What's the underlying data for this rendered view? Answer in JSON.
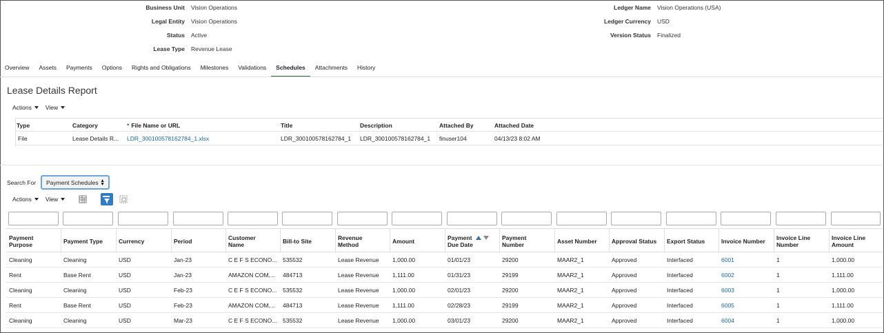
{
  "header": {
    "left": [
      {
        "label": "Business Unit",
        "value": "Vision Operations"
      },
      {
        "label": "Legal Entity",
        "value": "Vision Operations"
      },
      {
        "label": "Status",
        "value": "Active"
      },
      {
        "label": "Lease Type",
        "value": "Revenue Lease"
      }
    ],
    "right": [
      {
        "label": "Ledger Name",
        "value": "Vision Operations (USA)"
      },
      {
        "label": "Ledger Currency",
        "value": "USD"
      },
      {
        "label": "Version Status",
        "value": "Finalized"
      }
    ]
  },
  "tabs": [
    "Overview",
    "Assets",
    "Payments",
    "Options",
    "Rights and Obligations",
    "Milestones",
    "Validations",
    "Schedules",
    "Attachments",
    "History"
  ],
  "active_tab": "Schedules",
  "section_title": "Lease Details Report",
  "toolbar1": {
    "actions": "Actions",
    "view": "View"
  },
  "attachments": {
    "columns": [
      "Type",
      "Category",
      "File Name or URL",
      "Title",
      "Description",
      "Attached By",
      "Attached Date"
    ],
    "required_marker": "*",
    "rows": [
      {
        "type": "File",
        "category": "Lease Details R...",
        "file": "LDR_300100578162784_1.xlsx",
        "title": "LDR_300100578162784_1",
        "description": "LDR_300100578162784_1",
        "attached_by": "finuser104",
        "attached_date": "04/13/23 8:02 AM"
      }
    ]
  },
  "search": {
    "label": "Search For",
    "value": "Payment Schedules"
  },
  "toolbar2": {
    "actions": "Actions",
    "view": "View"
  },
  "payments": {
    "columns": [
      [
        "Payment",
        "Purpose"
      ],
      [
        "Payment Type",
        ""
      ],
      [
        "Currency",
        ""
      ],
      [
        "Period",
        ""
      ],
      [
        "Customer",
        "Name"
      ],
      [
        "Bill-to Site",
        ""
      ],
      [
        "Revenue",
        "Method"
      ],
      [
        "Amount",
        ""
      ],
      [
        "Payment",
        "Due Date"
      ],
      [
        "Payment",
        "Number"
      ],
      [
        "Asset Number",
        ""
      ],
      [
        "Approval Status",
        ""
      ],
      [
        "Export Status",
        ""
      ],
      [
        "Invoice Number",
        ""
      ],
      [
        "Invoice Line",
        "Number"
      ],
      [
        "Invoice Line",
        "Amount"
      ]
    ],
    "rows": [
      [
        "Cleaning",
        "Cleaning",
        "USD",
        "Jan-23",
        "C E F S ECONO...",
        "535532",
        "Lease Revenue",
        "1,000.00",
        "01/01/23",
        "29200",
        "MAAR2_1",
        "Approved",
        "Interfaced",
        "6001",
        "1",
        "1,000.00"
      ],
      [
        "Rent",
        "Base Rent",
        "USD",
        "Jan-23",
        "AMAZON COM,...",
        "484713",
        "Lease Revenue",
        "1,111.00",
        "01/31/23",
        "29199",
        "MAAR2_1",
        "Approved",
        "Interfaced",
        "6002",
        "1",
        "1,111.00"
      ],
      [
        "Cleaning",
        "Cleaning",
        "USD",
        "Feb-23",
        "C E F S ECONO...",
        "535532",
        "Lease Revenue",
        "1,000.00",
        "02/01/23",
        "29200",
        "MAAR2_1",
        "Approved",
        "Interfaced",
        "6003",
        "1",
        "1,000.00"
      ],
      [
        "Rent",
        "Base Rent",
        "USD",
        "Feb-23",
        "AMAZON COM,...",
        "484713",
        "Lease Revenue",
        "1,111.00",
        "02/28/23",
        "29199",
        "MAAR2_1",
        "Approved",
        "Interfaced",
        "6005",
        "1",
        "1,111.00"
      ],
      [
        "Cleaning",
        "Cleaning",
        "USD",
        "Mar-23",
        "C E F S ECONO...",
        "535532",
        "Lease Revenue",
        "1,000.00",
        "03/01/23",
        "29200",
        "MAAR2_1",
        "Approved",
        "Interfaced",
        "6004",
        "1",
        "1,000.00"
      ]
    ]
  },
  "colors": {
    "link": "#1a67a3",
    "active_tab_underline": "#2f6b3c",
    "active_icon": "#2f7cc5"
  }
}
